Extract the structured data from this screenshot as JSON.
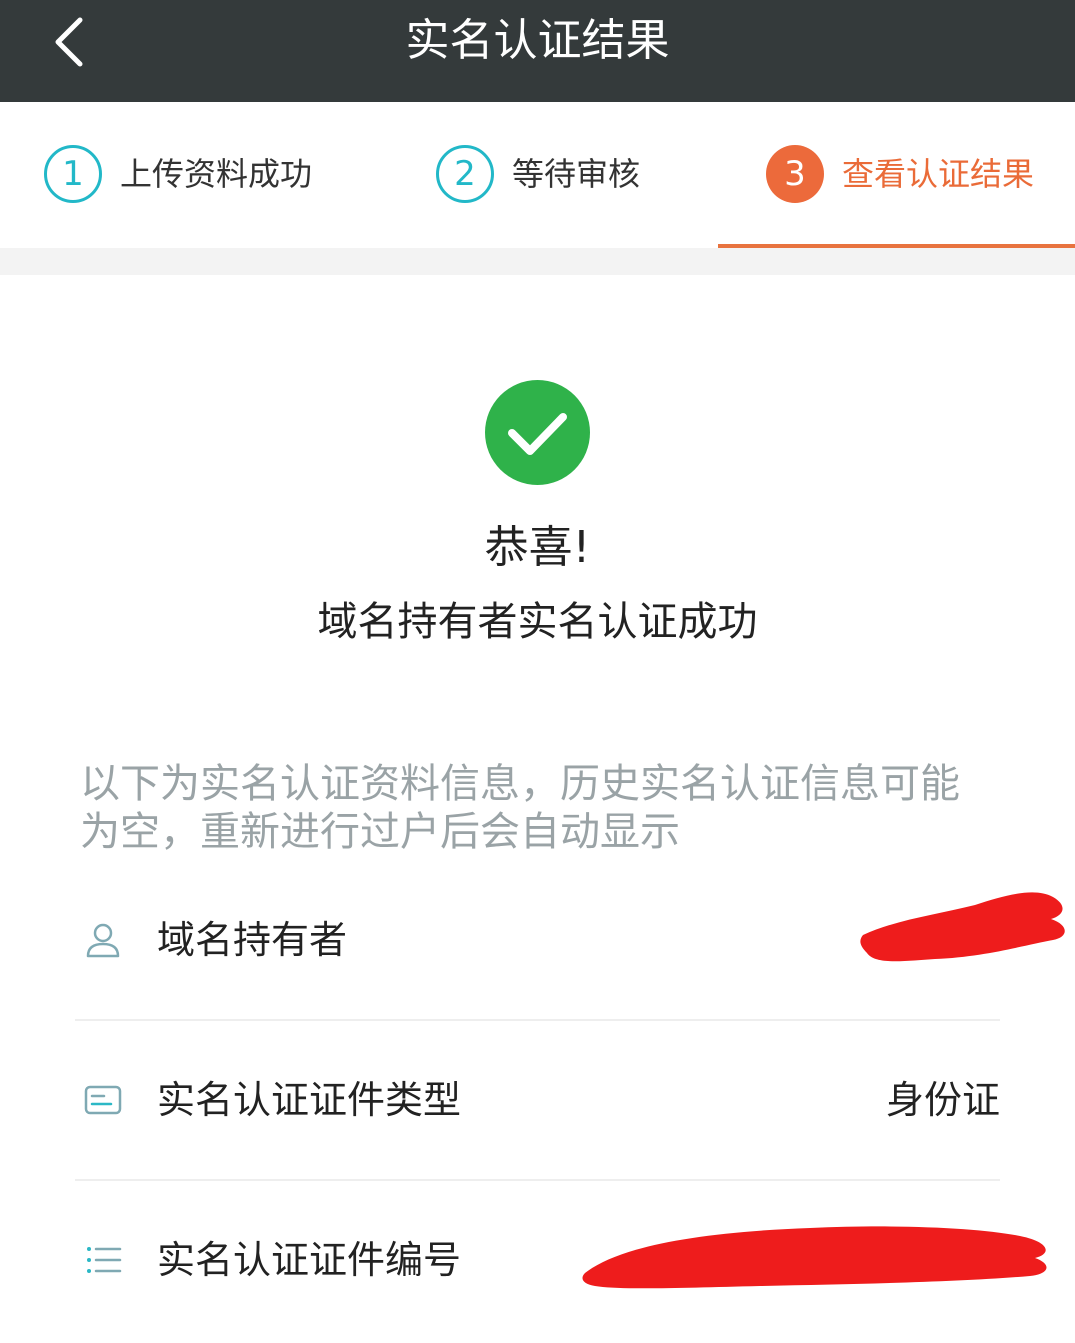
{
  "header": {
    "title": "实名认证结果"
  },
  "steps": [
    {
      "number": "1",
      "label": "上传资料成功",
      "active": false
    },
    {
      "number": "2",
      "label": "等待审核",
      "active": false
    },
    {
      "number": "3",
      "label": "查看认证结果",
      "active": true
    }
  ],
  "result": {
    "congrats": "恭喜!",
    "message": "域名持有者实名认证成功"
  },
  "info_note": "以下为实名认证资料信息，历史实名认证信息可能为空，重新进行过户后会自动显示",
  "details": [
    {
      "label": "域名持有者",
      "value": "",
      "icon": "person-icon",
      "redacted": true
    },
    {
      "label": "实名认证证件类型",
      "value": "身份证",
      "icon": "id-card-icon",
      "redacted": false
    },
    {
      "label": "实名认证证件编号",
      "value": "",
      "icon": "list-icon",
      "redacted": true
    }
  ],
  "colors": {
    "header_bg": "#343a3b",
    "step_inactive": "#22b8c8",
    "step_active": "#ec6a3b",
    "success_green": "#2fb24a",
    "redaction": "#ee1c1c"
  }
}
